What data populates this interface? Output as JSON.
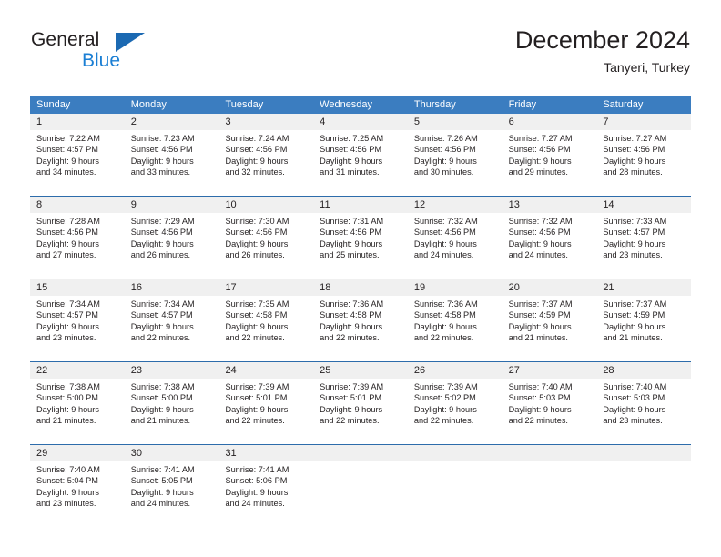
{
  "brand": {
    "name_part1": "General",
    "name_part2": "Blue",
    "triangle_color": "#1b69b2",
    "blue_color": "#1b7fd4"
  },
  "header": {
    "title": "December 2024",
    "subtitle": "Tanyeri, Turkey"
  },
  "theme": {
    "header_blue": "#3b7dc0",
    "row_border_blue": "#2d6cab",
    "day_band_gray": "#f0f0f0"
  },
  "weekdays": [
    "Sunday",
    "Monday",
    "Tuesday",
    "Wednesday",
    "Thursday",
    "Friday",
    "Saturday"
  ],
  "weeks": [
    [
      {
        "day": "1",
        "sunrise": "Sunrise: 7:22 AM",
        "sunset": "Sunset: 4:57 PM",
        "daylight_line1": "Daylight: 9 hours",
        "daylight_line2": "and 34 minutes."
      },
      {
        "day": "2",
        "sunrise": "Sunrise: 7:23 AM",
        "sunset": "Sunset: 4:56 PM",
        "daylight_line1": "Daylight: 9 hours",
        "daylight_line2": "and 33 minutes."
      },
      {
        "day": "3",
        "sunrise": "Sunrise: 7:24 AM",
        "sunset": "Sunset: 4:56 PM",
        "daylight_line1": "Daylight: 9 hours",
        "daylight_line2": "and 32 minutes."
      },
      {
        "day": "4",
        "sunrise": "Sunrise: 7:25 AM",
        "sunset": "Sunset: 4:56 PM",
        "daylight_line1": "Daylight: 9 hours",
        "daylight_line2": "and 31 minutes."
      },
      {
        "day": "5",
        "sunrise": "Sunrise: 7:26 AM",
        "sunset": "Sunset: 4:56 PM",
        "daylight_line1": "Daylight: 9 hours",
        "daylight_line2": "and 30 minutes."
      },
      {
        "day": "6",
        "sunrise": "Sunrise: 7:27 AM",
        "sunset": "Sunset: 4:56 PM",
        "daylight_line1": "Daylight: 9 hours",
        "daylight_line2": "and 29 minutes."
      },
      {
        "day": "7",
        "sunrise": "Sunrise: 7:27 AM",
        "sunset": "Sunset: 4:56 PM",
        "daylight_line1": "Daylight: 9 hours",
        "daylight_line2": "and 28 minutes."
      }
    ],
    [
      {
        "day": "8",
        "sunrise": "Sunrise: 7:28 AM",
        "sunset": "Sunset: 4:56 PM",
        "daylight_line1": "Daylight: 9 hours",
        "daylight_line2": "and 27 minutes."
      },
      {
        "day": "9",
        "sunrise": "Sunrise: 7:29 AM",
        "sunset": "Sunset: 4:56 PM",
        "daylight_line1": "Daylight: 9 hours",
        "daylight_line2": "and 26 minutes."
      },
      {
        "day": "10",
        "sunrise": "Sunrise: 7:30 AM",
        "sunset": "Sunset: 4:56 PM",
        "daylight_line1": "Daylight: 9 hours",
        "daylight_line2": "and 26 minutes."
      },
      {
        "day": "11",
        "sunrise": "Sunrise: 7:31 AM",
        "sunset": "Sunset: 4:56 PM",
        "daylight_line1": "Daylight: 9 hours",
        "daylight_line2": "and 25 minutes."
      },
      {
        "day": "12",
        "sunrise": "Sunrise: 7:32 AM",
        "sunset": "Sunset: 4:56 PM",
        "daylight_line1": "Daylight: 9 hours",
        "daylight_line2": "and 24 minutes."
      },
      {
        "day": "13",
        "sunrise": "Sunrise: 7:32 AM",
        "sunset": "Sunset: 4:56 PM",
        "daylight_line1": "Daylight: 9 hours",
        "daylight_line2": "and 24 minutes."
      },
      {
        "day": "14",
        "sunrise": "Sunrise: 7:33 AM",
        "sunset": "Sunset: 4:57 PM",
        "daylight_line1": "Daylight: 9 hours",
        "daylight_line2": "and 23 minutes."
      }
    ],
    [
      {
        "day": "15",
        "sunrise": "Sunrise: 7:34 AM",
        "sunset": "Sunset: 4:57 PM",
        "daylight_line1": "Daylight: 9 hours",
        "daylight_line2": "and 23 minutes."
      },
      {
        "day": "16",
        "sunrise": "Sunrise: 7:34 AM",
        "sunset": "Sunset: 4:57 PM",
        "daylight_line1": "Daylight: 9 hours",
        "daylight_line2": "and 22 minutes."
      },
      {
        "day": "17",
        "sunrise": "Sunrise: 7:35 AM",
        "sunset": "Sunset: 4:58 PM",
        "daylight_line1": "Daylight: 9 hours",
        "daylight_line2": "and 22 minutes."
      },
      {
        "day": "18",
        "sunrise": "Sunrise: 7:36 AM",
        "sunset": "Sunset: 4:58 PM",
        "daylight_line1": "Daylight: 9 hours",
        "daylight_line2": "and 22 minutes."
      },
      {
        "day": "19",
        "sunrise": "Sunrise: 7:36 AM",
        "sunset": "Sunset: 4:58 PM",
        "daylight_line1": "Daylight: 9 hours",
        "daylight_line2": "and 22 minutes."
      },
      {
        "day": "20",
        "sunrise": "Sunrise: 7:37 AM",
        "sunset": "Sunset: 4:59 PM",
        "daylight_line1": "Daylight: 9 hours",
        "daylight_line2": "and 21 minutes."
      },
      {
        "day": "21",
        "sunrise": "Sunrise: 7:37 AM",
        "sunset": "Sunset: 4:59 PM",
        "daylight_line1": "Daylight: 9 hours",
        "daylight_line2": "and 21 minutes."
      }
    ],
    [
      {
        "day": "22",
        "sunrise": "Sunrise: 7:38 AM",
        "sunset": "Sunset: 5:00 PM",
        "daylight_line1": "Daylight: 9 hours",
        "daylight_line2": "and 21 minutes."
      },
      {
        "day": "23",
        "sunrise": "Sunrise: 7:38 AM",
        "sunset": "Sunset: 5:00 PM",
        "daylight_line1": "Daylight: 9 hours",
        "daylight_line2": "and 21 minutes."
      },
      {
        "day": "24",
        "sunrise": "Sunrise: 7:39 AM",
        "sunset": "Sunset: 5:01 PM",
        "daylight_line1": "Daylight: 9 hours",
        "daylight_line2": "and 22 minutes."
      },
      {
        "day": "25",
        "sunrise": "Sunrise: 7:39 AM",
        "sunset": "Sunset: 5:01 PM",
        "daylight_line1": "Daylight: 9 hours",
        "daylight_line2": "and 22 minutes."
      },
      {
        "day": "26",
        "sunrise": "Sunrise: 7:39 AM",
        "sunset": "Sunset: 5:02 PM",
        "daylight_line1": "Daylight: 9 hours",
        "daylight_line2": "and 22 minutes."
      },
      {
        "day": "27",
        "sunrise": "Sunrise: 7:40 AM",
        "sunset": "Sunset: 5:03 PM",
        "daylight_line1": "Daylight: 9 hours",
        "daylight_line2": "and 22 minutes."
      },
      {
        "day": "28",
        "sunrise": "Sunrise: 7:40 AM",
        "sunset": "Sunset: 5:03 PM",
        "daylight_line1": "Daylight: 9 hours",
        "daylight_line2": "and 23 minutes."
      }
    ],
    [
      {
        "day": "29",
        "sunrise": "Sunrise: 7:40 AM",
        "sunset": "Sunset: 5:04 PM",
        "daylight_line1": "Daylight: 9 hours",
        "daylight_line2": "and 23 minutes."
      },
      {
        "day": "30",
        "sunrise": "Sunrise: 7:41 AM",
        "sunset": "Sunset: 5:05 PM",
        "daylight_line1": "Daylight: 9 hours",
        "daylight_line2": "and 24 minutes."
      },
      {
        "day": "31",
        "sunrise": "Sunrise: 7:41 AM",
        "sunset": "Sunset: 5:06 PM",
        "daylight_line1": "Daylight: 9 hours",
        "daylight_line2": "and 24 minutes."
      },
      {
        "day": "",
        "sunrise": "",
        "sunset": "",
        "daylight_line1": "",
        "daylight_line2": ""
      },
      {
        "day": "",
        "sunrise": "",
        "sunset": "",
        "daylight_line1": "",
        "daylight_line2": ""
      },
      {
        "day": "",
        "sunrise": "",
        "sunset": "",
        "daylight_line1": "",
        "daylight_line2": ""
      },
      {
        "day": "",
        "sunrise": "",
        "sunset": "",
        "daylight_line1": "",
        "daylight_line2": ""
      }
    ]
  ]
}
